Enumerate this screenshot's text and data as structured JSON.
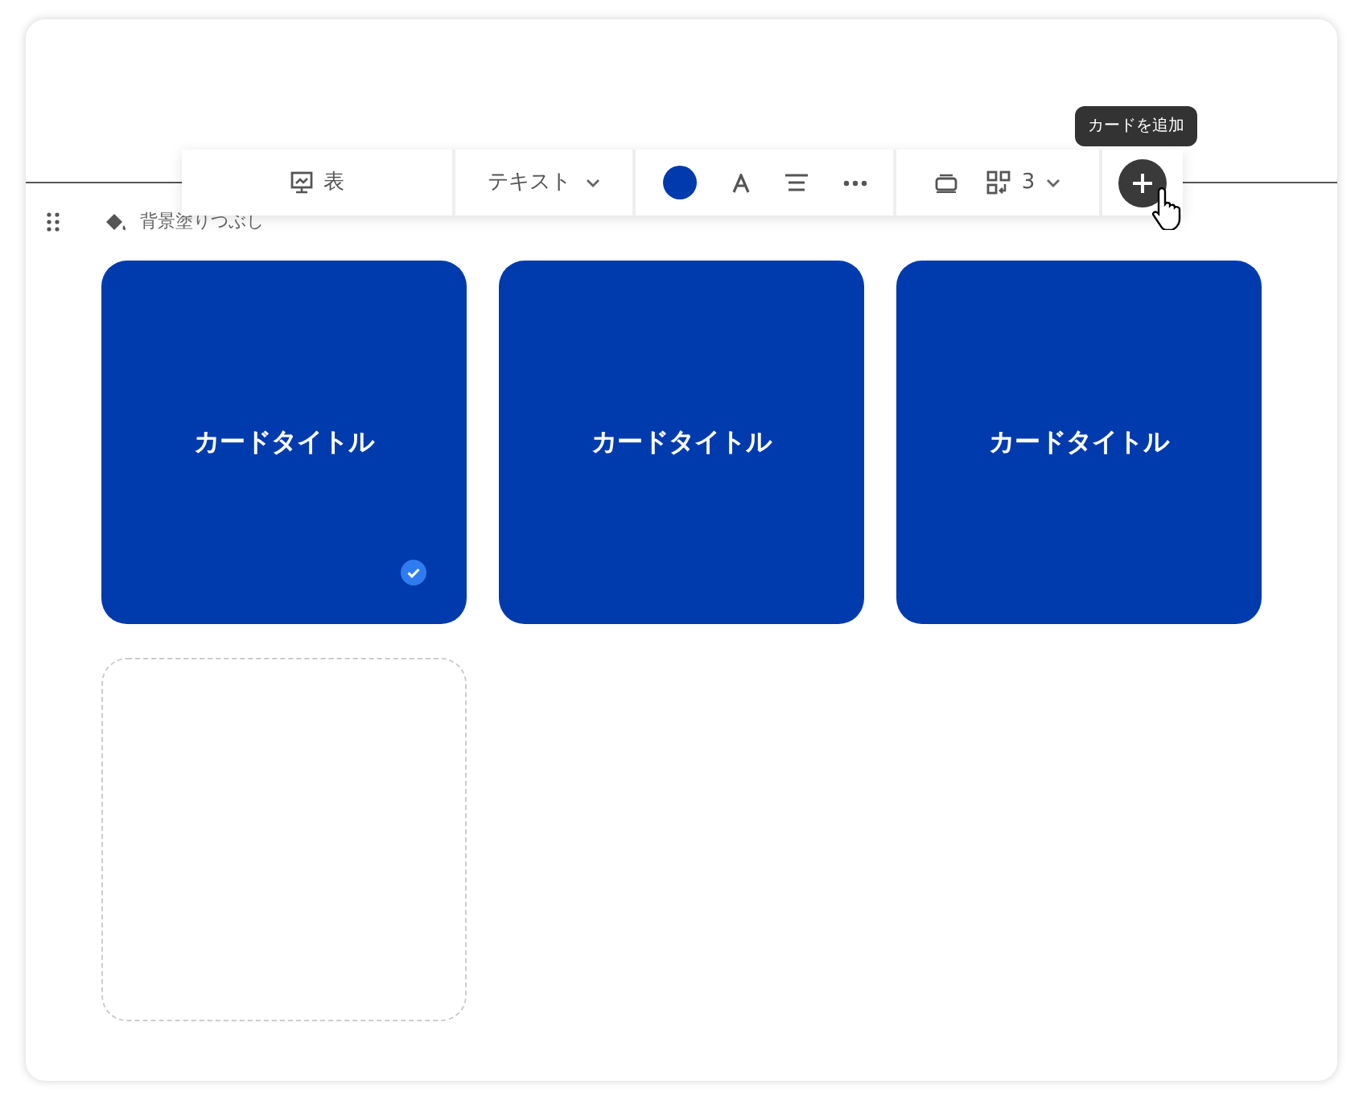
{
  "toolbar": {
    "view_label": "表",
    "text_style": "テキスト",
    "color": "#003bae",
    "columns": "3",
    "add_tooltip": "カードを追加"
  },
  "section": {
    "label": "背景塗りつぶし"
  },
  "cards": [
    {
      "kind": "card",
      "title": "カードタイトル",
      "selected": true
    },
    {
      "kind": "card",
      "title": "カードタイトル",
      "selected": false
    },
    {
      "kind": "card",
      "title": "カードタイトル",
      "selected": false
    },
    {
      "kind": "empty"
    }
  ]
}
